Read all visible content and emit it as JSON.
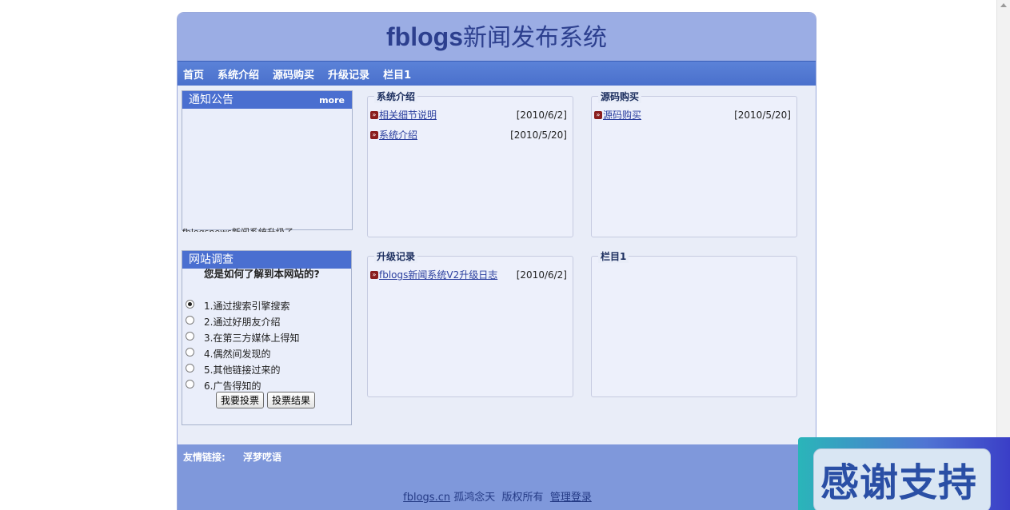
{
  "site": {
    "title_main": "fblogs",
    "title_suffix": "新闻发布系统"
  },
  "nav": {
    "items": [
      "首页",
      "系统介绍",
      "源码购买",
      "升级记录",
      "栏目1"
    ]
  },
  "notice": {
    "title": "通知公告",
    "more": "more",
    "scrolling_text": "fblogsnews新闻系统升级了"
  },
  "survey": {
    "title": "网站调查",
    "question": "您是如何了解到本网站的?",
    "options": [
      "1.通过搜索引擎搜索",
      "2.通过好朋友介绍",
      "3.在第三方媒体上得知",
      "4.偶然间发现的",
      "5.其他链接过来的",
      "6.广告得知的"
    ],
    "selected_index": 0,
    "vote_button": "我要投票",
    "result_button": "投票结果"
  },
  "boxes": {
    "intro": {
      "title": "系统介绍",
      "items": [
        {
          "text": "相关细节说明",
          "date": "[2010/6/2]"
        },
        {
          "text": "系统介绍",
          "date": "[2010/5/20]"
        }
      ]
    },
    "buy": {
      "title": "源码购买",
      "items": [
        {
          "text": "源码购买",
          "date": "[2010/5/20]"
        }
      ]
    },
    "upgrade": {
      "title": "升级记录",
      "items": [
        {
          "text": "fblogs新闻系统V2升级日志",
          "date": "[2010/6/2]"
        }
      ]
    },
    "col1": {
      "title": "栏目1",
      "items": []
    }
  },
  "footer": {
    "friends_label": "友情链接:",
    "friend_link": "浮梦呓语",
    "copyright_link": "fblogs.cn",
    "copyright_author": "孤鸿念天",
    "copyright_rights": "版权所有",
    "admin_login": "管理登录"
  },
  "promo": {
    "text": "感谢支持"
  },
  "colors": {
    "header": "#9bade4",
    "nav": "#4a70cc",
    "panel_head": "#4a6fd0",
    "footer": "#7f98db",
    "title": "#2c3f8e"
  }
}
